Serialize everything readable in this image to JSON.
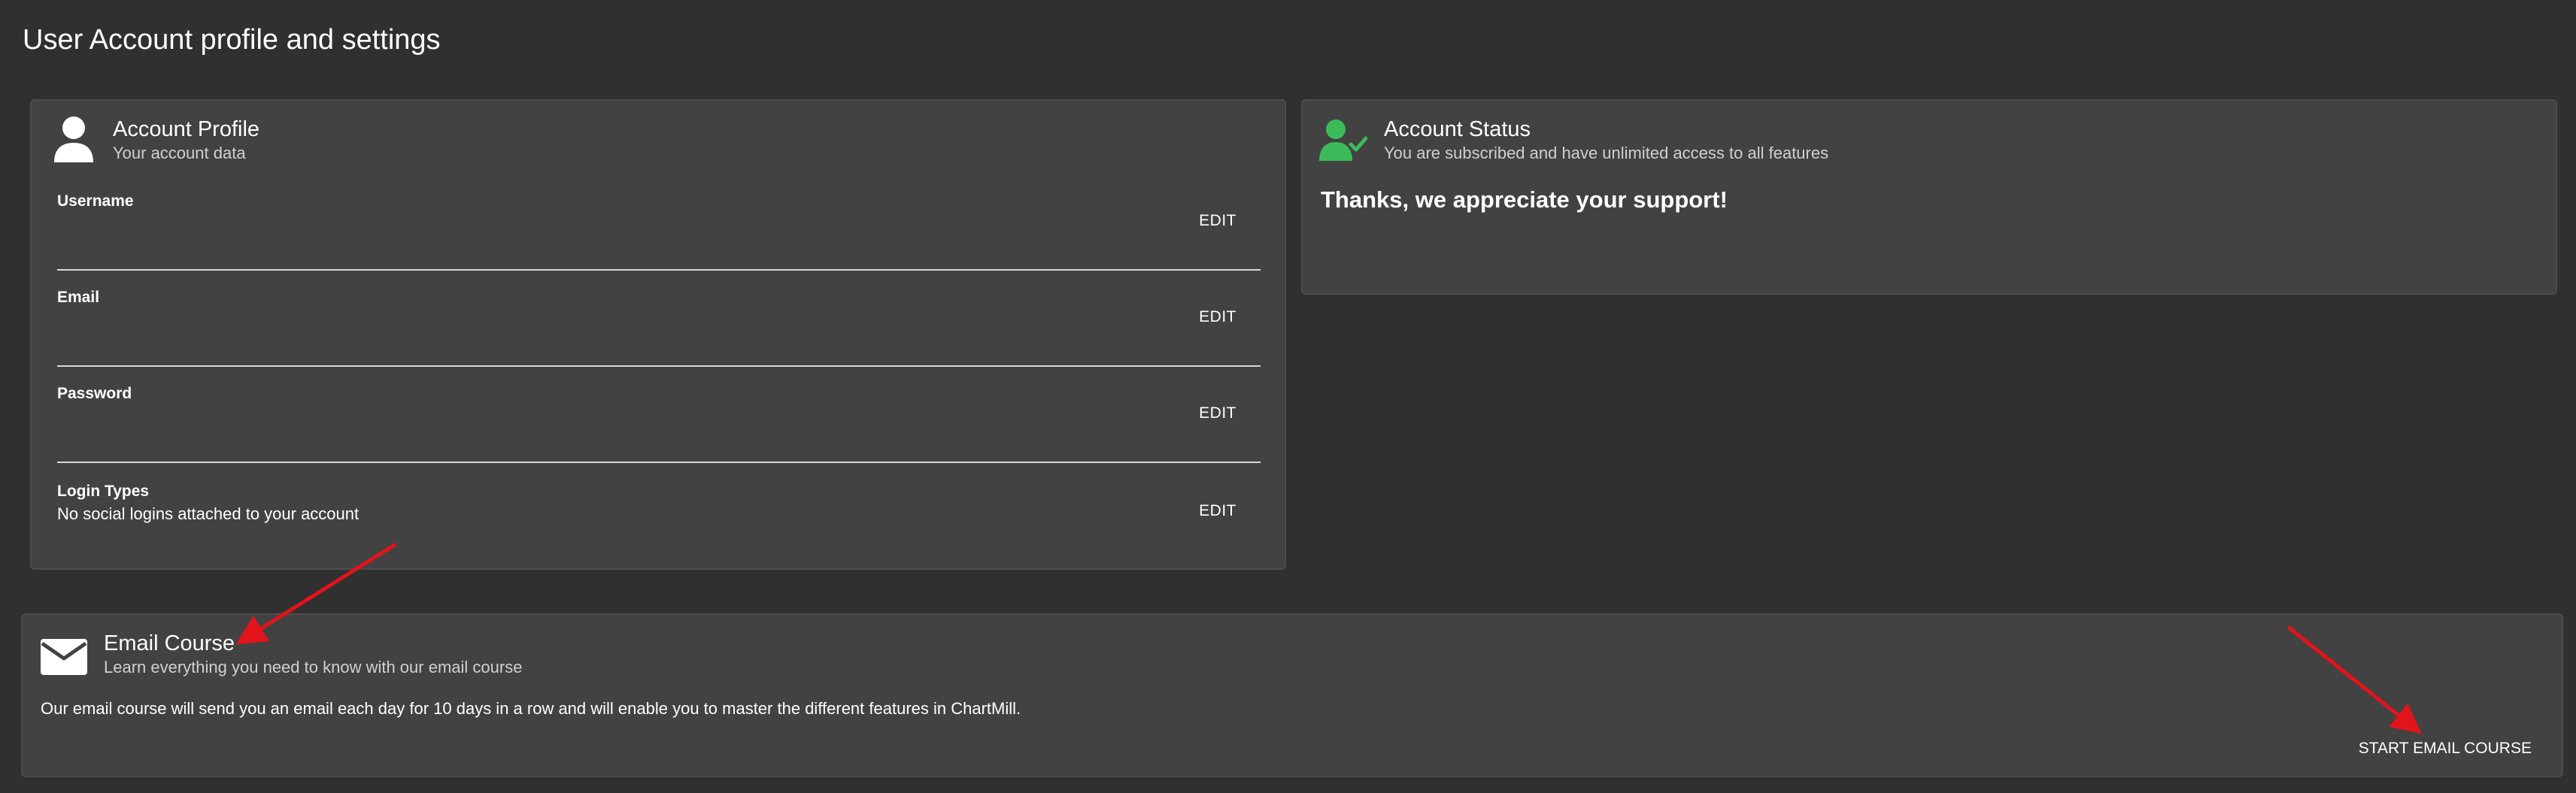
{
  "page": {
    "title": "User Account profile and settings"
  },
  "profile": {
    "title": "Account Profile",
    "subtitle": "Your account data",
    "icon": "person-icon",
    "edit_label": "EDIT",
    "fields": [
      {
        "label": "Username",
        "value": ""
      },
      {
        "label": "Email",
        "value": ""
      },
      {
        "label": "Password",
        "value": ""
      },
      {
        "label": "Login Types",
        "value": "No social logins attached to your account"
      }
    ]
  },
  "status": {
    "title": "Account Status",
    "subtitle": "You are subscribed and have unlimited access to all features",
    "icon": "person-check-icon",
    "message": "Thanks, we appreciate your support!",
    "accent_color": "#3dbb5a"
  },
  "course": {
    "title": "Email Course",
    "subtitle": "Learn everything you need to know with our email course",
    "icon": "envelope-icon",
    "description": "Our email course will send you an email each day for 10 days in a row and will enable you to master the different features in ChartMill.",
    "button_label": "START EMAIL COURSE"
  },
  "annotations": {
    "arrow_color": "#e3131b"
  }
}
